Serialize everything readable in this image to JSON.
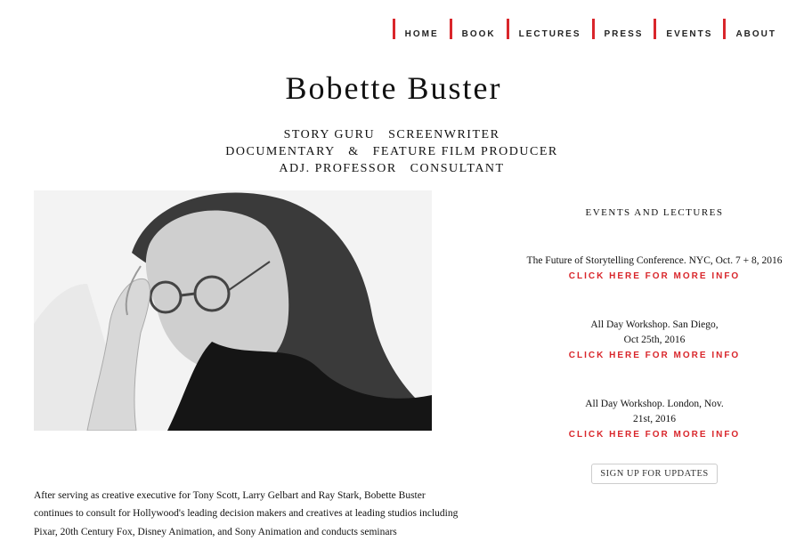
{
  "nav": [
    "HOME",
    "BOOK",
    "LECTURES",
    "PRESS",
    "EVENTS",
    "ABOUT"
  ],
  "site_title": "Bobette Buster",
  "roles": [
    "STORY GURU   SCREENWRITER",
    "DOCUMENTARY   &   FEATURE FILM PRODUCER",
    "ADJ. PROFESSOR   CONSULTANT"
  ],
  "sidebar": {
    "title": "EVENTS AND LECTURES",
    "events": [
      {
        "desc": "The Future of Storytelling Conference. NYC, Oct. 7 + 8, 2016",
        "link": "CLICK HERE FOR MORE INFO"
      },
      {
        "desc": "All Day Workshop. San Diego, Oct 25th, 2016",
        "link": "CLICK HERE FOR MORE INFO"
      },
      {
        "desc": "All Day Workshop. London, Nov. 21st, 2016",
        "link": "CLICK HERE FOR MORE INFO"
      }
    ],
    "signup": "SIGN UP FOR UPDATES"
  },
  "bio": "After serving as creative executive for Tony Scott, Larry Gelbart and Ray Stark, Bobette Buster continues to consult for Hollywood's leading decision makers and creatives at leading studios including Pixar, 20th Century Fox, Disney Animation, and Sony Animation and conducts seminars"
}
